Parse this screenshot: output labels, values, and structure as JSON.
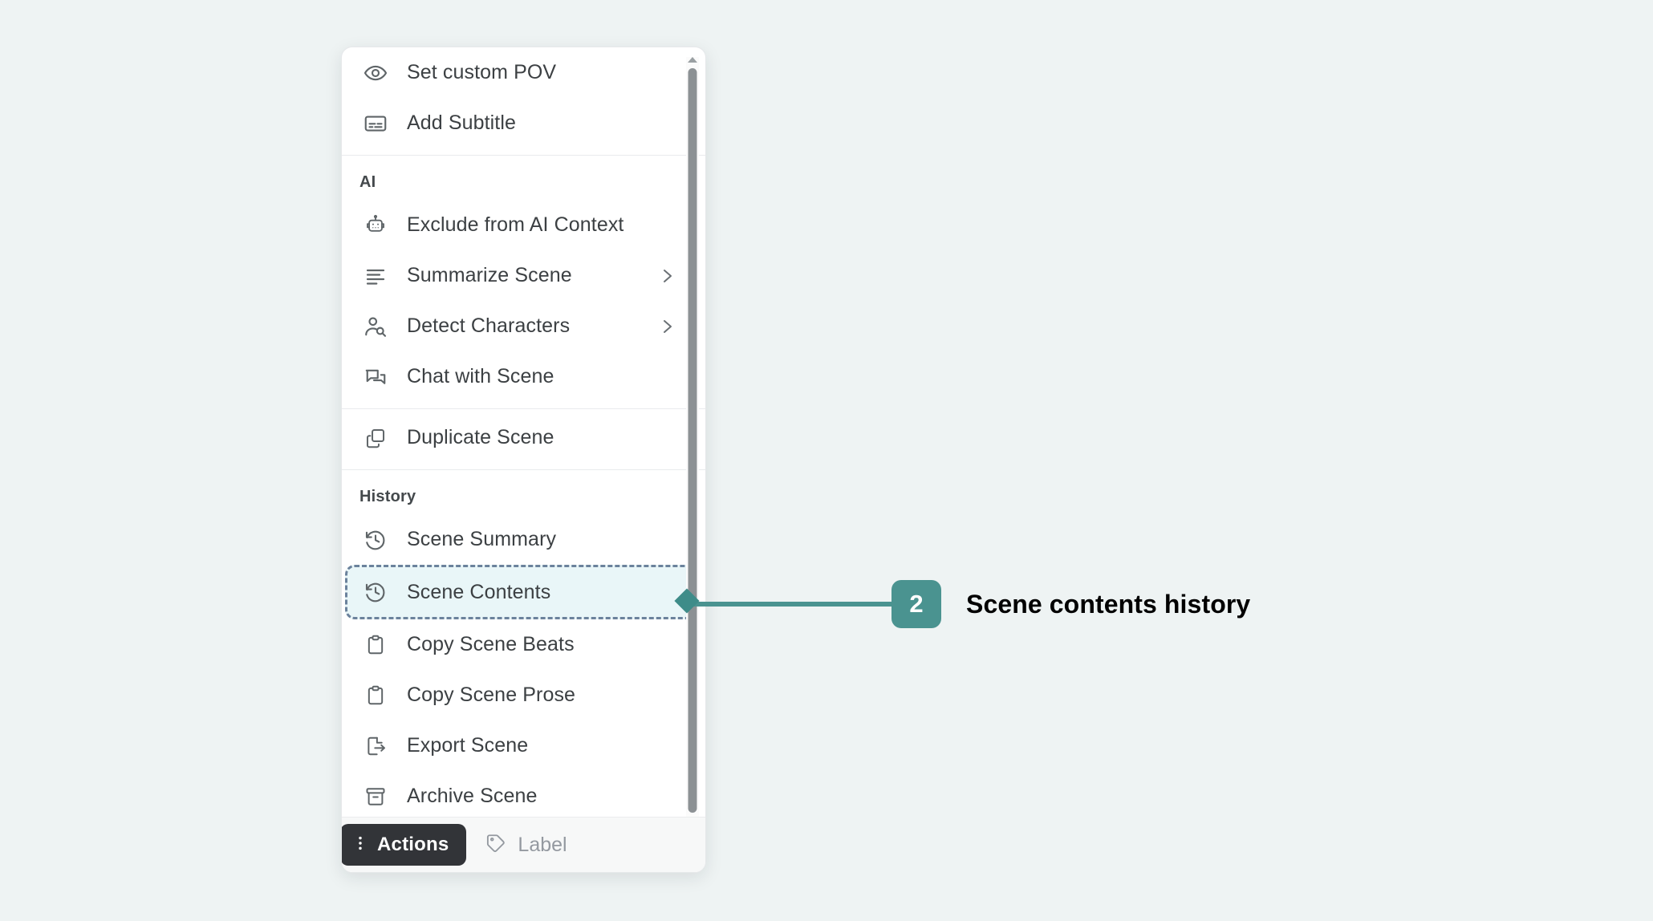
{
  "background_color": "#eef3f3",
  "menu": {
    "groups": [
      {
        "id": "top",
        "header": null,
        "items": [
          {
            "label": "Set custom POV",
            "icon": "eye-icon",
            "submenu": false
          },
          {
            "label": "Add Subtitle",
            "icon": "subtitle-icon",
            "submenu": false
          }
        ]
      },
      {
        "id": "ai",
        "header": "AI",
        "items": [
          {
            "label": "Exclude from AI Context",
            "icon": "robot-icon",
            "submenu": false
          },
          {
            "label": "Summarize Scene",
            "icon": "list-lines-icon",
            "submenu": true
          },
          {
            "label": "Detect Characters",
            "icon": "person-search-icon",
            "submenu": true
          },
          {
            "label": "Chat with Scene",
            "icon": "chat-bubbles-icon",
            "submenu": false
          }
        ]
      },
      {
        "id": "duplicate",
        "header": null,
        "items": [
          {
            "label": "Duplicate Scene",
            "icon": "copy-icon",
            "submenu": false
          }
        ]
      },
      {
        "id": "history",
        "header": "History",
        "items": [
          {
            "label": "Scene Summary",
            "icon": "history-clock-icon",
            "submenu": false
          },
          {
            "label": "Scene Contents",
            "icon": "history-clock-icon",
            "submenu": false,
            "highlighted": true
          },
          {
            "label": "Copy Scene Beats",
            "icon": "clipboard-icon",
            "submenu": false
          },
          {
            "label": "Copy Scene Prose",
            "icon": "clipboard-icon",
            "submenu": false
          },
          {
            "label": "Export Scene",
            "icon": "export-file-icon",
            "submenu": false
          },
          {
            "label": "Archive Scene",
            "icon": "archive-icon",
            "submenu": false
          }
        ]
      }
    ],
    "submenu_chevron": "chevron-right-icon",
    "highlight": {
      "border_color": "#6b829c",
      "fill_color": "#e9f6f8"
    },
    "scrollbar": {
      "arrow_up": "triangle-up-icon",
      "arrow_down": "triangle-down-icon",
      "thumb_color": "#8c9194"
    }
  },
  "bottom_bar": {
    "actions": {
      "label": "Actions",
      "icon": "vertical-dots-icon",
      "background": "#323438"
    },
    "label_item": {
      "label": "Label",
      "icon": "tag-icon",
      "color": "#9499a0"
    }
  },
  "callout": {
    "number": "2",
    "text": "Scene contents history",
    "accent_color": "#4a9390"
  }
}
